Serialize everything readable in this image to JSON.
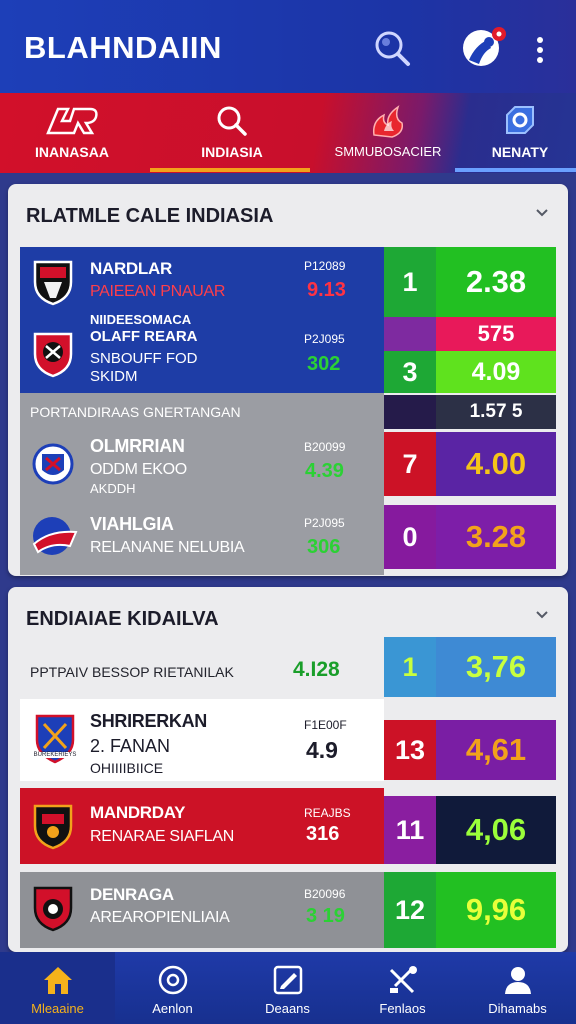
{
  "header": {
    "brand": "BLAHNDAIIN",
    "colors": {
      "primary": "#1d3fb8",
      "accent": "#d2102a",
      "highlight": "#f5b21b"
    },
    "icons": [
      "search-icon",
      "profile-icon",
      "more-vertical-icon"
    ]
  },
  "tabs": [
    {
      "label": "INANASAA",
      "icon": "logo-icon"
    },
    {
      "label": "INDIASIA",
      "icon": "search-icon"
    },
    {
      "label": "SMMUBOSACIER",
      "icon": "fire-icon"
    },
    {
      "label": "NENATY",
      "icon": "tag-icon"
    }
  ],
  "section1": {
    "title": "RLATMLE CALE INDIASIA",
    "row1": {
      "name": "NARDLAR",
      "sub": "PAIEEAN PNAUAR",
      "code": "P12089",
      "stat": "9.13",
      "box1": "1",
      "box2": "2.38"
    },
    "row2": {
      "name_line1": "NIIDEESOMACA",
      "name_line2": "OLAFF REARA",
      "sub_line1": "SNBOUFF FOD",
      "sub_line2": "SKIDM",
      "code": "P2J095",
      "stat": "302",
      "box_top": "575",
      "box1": "3",
      "box2": "4.09"
    },
    "subheader": {
      "label": "PORTANDIRAAS GNERTANGAN",
      "box": "1.57 5"
    },
    "row3": {
      "name": "OLMRRIAN",
      "sub_line1": "ODDM EKOO",
      "sub_line2": "AKDDH",
      "code": "B20099",
      "stat": "4.39",
      "box1": "7",
      "box2": "4.00"
    },
    "row4": {
      "name": "VIAHLGIA",
      "sub": "RELANANE NELUBIA",
      "code": "P2J095",
      "stat": "306",
      "box1": "0",
      "box2": "3.28"
    }
  },
  "section2": {
    "title": "ENDIAIAE KIDAILVA",
    "subheader": {
      "label": "PPTPAIV BESSOP RIETANILAK",
      "stat": "4.I28",
      "box1": "1",
      "box2": "3,76"
    },
    "row1": {
      "name": "SHRIRERKAN",
      "sub_line1": "2. FANAN",
      "sub_line2": "OHIIIIBIICE",
      "code": "F1E00F",
      "stat": "4.9",
      "crest_text": "BUREKERIEYS",
      "box1": "13",
      "box2": "4,61"
    },
    "row2": {
      "name": "MANDRDAY",
      "sub": "RENARAE SIAFLAN",
      "code": "REAJBS",
      "stat": "316",
      "box1": "11",
      "box2": "4,06"
    },
    "row3": {
      "name": "DENRAGA",
      "sub": "AREAROPIENLIAIA",
      "code": "B20096",
      "stat": "3 19",
      "box1": "12",
      "box2": "9,96"
    }
  },
  "bottom_nav": [
    {
      "label": "Mleaaine",
      "icon": "home-icon",
      "active": true
    },
    {
      "label": "Aenlon",
      "icon": "target-icon",
      "active": false
    },
    {
      "label": "Deaans",
      "icon": "edit-icon",
      "active": false
    },
    {
      "label": "Fenlaos",
      "icon": "tools-icon",
      "active": false
    },
    {
      "label": "Dihamabs",
      "icon": "user-icon",
      "active": false
    }
  ]
}
